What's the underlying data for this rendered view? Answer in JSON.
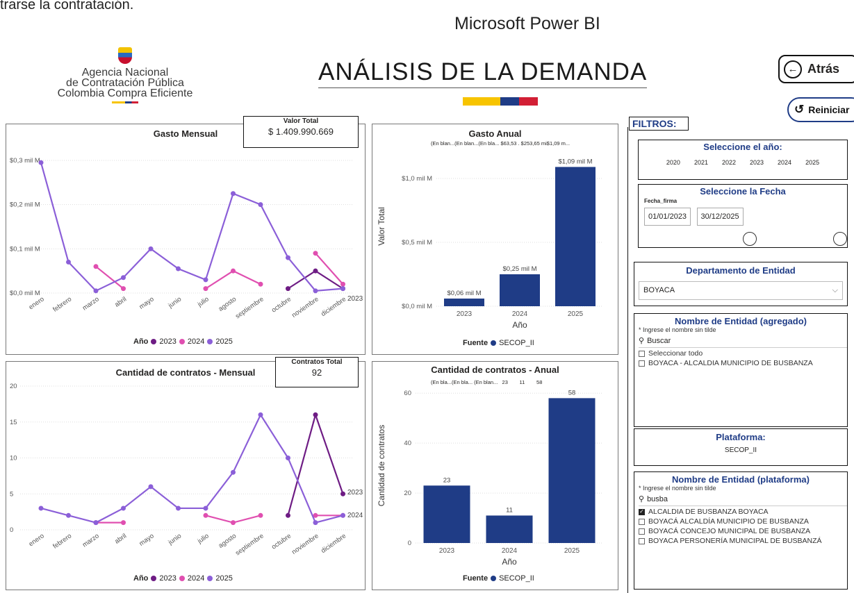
{
  "top_cut_text": "trarse la contratación.",
  "window_title": "Microsoft Power BI",
  "logo": {
    "line1": "Agencia Nacional",
    "line2": "de Contratación Pública",
    "line3": "Colombia Compra Eficiente"
  },
  "page_title": "ANÁLISIS DE LA DEMANDA",
  "buttons": {
    "back": "Atrás",
    "back_icon": "←",
    "reset": "Reiniciar",
    "reset_icon": "↺"
  },
  "colors": {
    "c2023": "#6e1c84",
    "c2024": "#e04fb0",
    "c2025": "#8b5fd8",
    "bar": "#1f3c86",
    "flag_yellow": "#f7c400",
    "flag_blue": "#1f3c86",
    "flag_red": "#d21f35"
  },
  "kpis": {
    "valor_total_label": "Valor Total",
    "valor_total": "$ 1.409.990.669",
    "contratos_total_label": "Contratos Total",
    "contratos_total": "92"
  },
  "legend": {
    "title": "Año",
    "y2023": "2023",
    "y2024": "2024",
    "y2025": "2025",
    "fuente_title": "Fuente",
    "fuente": "SECOP_II"
  },
  "months": [
    "enero",
    "febrero",
    "marzo",
    "abril",
    "mayo",
    "junio",
    "julio",
    "agosto",
    "septiembre",
    "octubre",
    "noviembre",
    "diciembre"
  ],
  "chart_data": [
    {
      "type": "line",
      "title": "Gasto Mensual",
      "categories": [
        "enero",
        "febrero",
        "marzo",
        "abril",
        "mayo",
        "junio",
        "julio",
        "agosto",
        "septiembre",
        "octubre",
        "noviembre",
        "diciembre"
      ],
      "yticks": [
        "$0,0 mil M",
        "$0,1 mil M",
        "$0,2 mil M",
        "$0,3 mil M"
      ],
      "ylim": [
        0,
        0.3
      ],
      "series": [
        {
          "name": "2023",
          "values": [
            null,
            null,
            null,
            null,
            null,
            null,
            null,
            null,
            null,
            0.01,
            0.05,
            0.01
          ]
        },
        {
          "name": "2024",
          "values": [
            null,
            null,
            0.06,
            0.01,
            null,
            null,
            0.01,
            0.05,
            0.02,
            null,
            0.09,
            0.02
          ]
        },
        {
          "name": "2025",
          "values": [
            0.295,
            0.07,
            0.005,
            0.035,
            0.1,
            0.055,
            0.03,
            0.225,
            0.2,
            0.08,
            0.005,
            0.01
          ]
        }
      ],
      "end_label": "2023"
    },
    {
      "type": "bar",
      "title": "Gasto Anual",
      "header_labels": "(En blan...(En blan...(En bla...   $63,53 . $253,65 mi$1,09 m...",
      "categories": [
        "2023",
        "2024",
        "2025"
      ],
      "values": [
        0.06,
        0.25,
        1.09
      ],
      "data_labels": [
        "$0,06 mil M",
        "$0,25 mil M",
        "$1,09 mil M"
      ],
      "yticks": [
        "$0,0 mil M",
        "$0,5 mil M",
        "$1,0 mil M"
      ],
      "ylim": [
        0,
        1.25
      ],
      "xlabel": "Año",
      "ylabel": "Valor Total"
    },
    {
      "type": "line",
      "title": "Cantidad de contratos - Mensual",
      "categories": [
        "enero",
        "febrero",
        "marzo",
        "abril",
        "mayo",
        "junio",
        "julio",
        "agosto",
        "septiembre",
        "octubre",
        "noviembre",
        "diciembre"
      ],
      "yticks": [
        "0",
        "5",
        "10",
        "15",
        "20"
      ],
      "ylim": [
        0,
        20
      ],
      "series": [
        {
          "name": "2023",
          "values": [
            null,
            null,
            null,
            null,
            null,
            null,
            null,
            null,
            null,
            2,
            16,
            5
          ]
        },
        {
          "name": "2024",
          "values": [
            null,
            null,
            1,
            1,
            null,
            null,
            2,
            1,
            2,
            null,
            2,
            2
          ]
        },
        {
          "name": "2025",
          "values": [
            3,
            2,
            1,
            3,
            6,
            3,
            3,
            8,
            16,
            10,
            1,
            2
          ]
        }
      ],
      "end_labels": [
        "2023",
        "2024"
      ]
    },
    {
      "type": "bar",
      "title": "Cantidad de contratos - Anual",
      "header_labels": "(En bla...(En bla... (En blan...   23        11        58",
      "categories": [
        "2023",
        "2024",
        "2025"
      ],
      "values": [
        23,
        11,
        58
      ],
      "data_labels": [
        "23",
        "11",
        "58"
      ],
      "yticks": [
        "0",
        "20",
        "40",
        "60"
      ],
      "ylim": [
        0,
        62
      ],
      "xlabel": "Año",
      "ylabel": "Cantidad de contratos"
    }
  ],
  "filters": {
    "label": "FILTROS:",
    "year_title": "Seleccione el año:",
    "years": [
      "2020",
      "2021",
      "2022",
      "2023",
      "2024",
      "2025"
    ],
    "date_title": "Seleccione la Fecha",
    "date_field": "Fecha_firma",
    "date_from": "01/01/2023",
    "date_to": "30/12/2025",
    "dept_title": "Departamento de Entidad",
    "dept_value": "BOYACA",
    "entity_title": "Nombre de Entidad (agregado)",
    "entity_hint": "* Ingrese el nombre sin tilde",
    "entity_search_placeholder": "Buscar",
    "entity_options": [
      "Seleccionar todo",
      "BOYACA - ALCALDIA MUNICIPIO DE BUSBANZA"
    ],
    "platform_title": "Plataforma:",
    "platform_value": "SECOP_II",
    "entity_platform_title": "Nombre de Entidad (plataforma)",
    "entity_platform_hint": "* Ingrese el nombre sin tilde",
    "entity_platform_search": "busba",
    "entity_platform_options": [
      {
        "label": "ALCALDIA DE BUSBANZA BOYACA",
        "checked": true
      },
      {
        "label": "BOYACÁ ALCALDÍA MUNICIPIO DE BUSBANZA",
        "checked": false
      },
      {
        "label": "BOYACÁ CONCEJO MUNICIPAL DE BUSBANZA",
        "checked": false
      },
      {
        "label": "BOYACA PERSONERÍA MUNICIPAL DE BUSBANZÁ",
        "checked": false
      }
    ]
  }
}
